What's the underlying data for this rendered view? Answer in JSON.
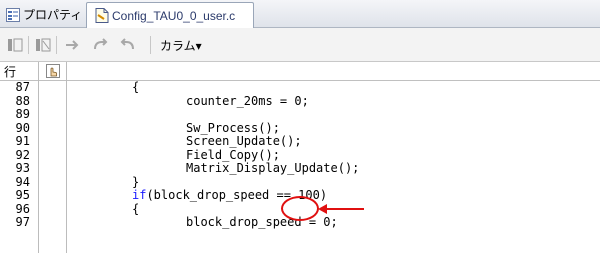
{
  "tabs": [
    {
      "label": "プロパティ",
      "icon": "properties-icon"
    },
    {
      "label": "Config_TAU0_0_user.c",
      "icon": "c-file-icon",
      "active": true
    }
  ],
  "toolbar": {
    "buttons": [
      "bookmark-toggle-icon",
      "bookmark-clear-icon",
      "forward-arrow-icon",
      "redo-icon",
      "undo-icon"
    ],
    "column_menu": "カラム▾"
  },
  "editor": {
    "header_line_label": "行",
    "lines": [
      {
        "num": "87",
        "indent": 0,
        "text": "{"
      },
      {
        "num": "88",
        "indent": 1,
        "text": "counter_20ms = 0;"
      },
      {
        "num": "89",
        "indent": 1,
        "text": ""
      },
      {
        "num": "90",
        "indent": 1,
        "text": "Sw_Process();"
      },
      {
        "num": "91",
        "indent": 1,
        "text": "Screen_Update();"
      },
      {
        "num": "92",
        "indent": 1,
        "text": "Field_Copy();"
      },
      {
        "num": "93",
        "indent": 1,
        "text": "Matrix_Display_Update();"
      },
      {
        "num": "94",
        "indent": 0,
        "text": "}"
      },
      {
        "num": "95",
        "indent": 0,
        "text": "if(block_drop_speed == 100)",
        "keyword": "if"
      },
      {
        "num": "96",
        "indent": 0,
        "text": "{"
      },
      {
        "num": "97",
        "indent": 1,
        "text": "block_drop_speed = 0;"
      }
    ]
  },
  "colors": {
    "annotation": "#e01010",
    "keyword": "#1a1aff"
  }
}
